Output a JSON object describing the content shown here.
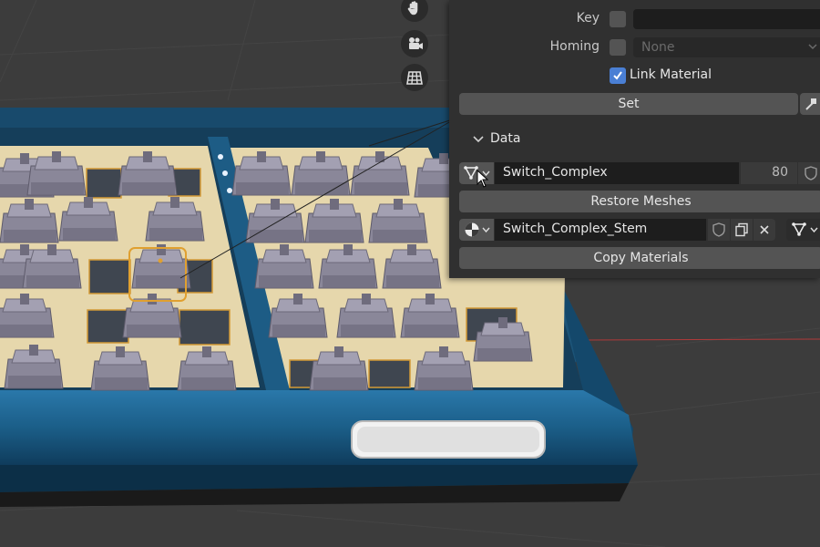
{
  "panel": {
    "key_label": "Key",
    "homing_label": "Homing",
    "homing_value": "None",
    "link_material_label": "Link Material",
    "link_material_checked": true,
    "set_label": "Set",
    "data_section_label": "Data",
    "mesh_name": "Switch_Complex",
    "mesh_users": "80",
    "restore_meshes_label": "Restore Meshes",
    "material_name": "Switch_Complex_Stem",
    "copy_materials_label": "Copy Materials"
  },
  "icons": {
    "viewport_tools": [
      "hand-icon",
      "camera-icon",
      "grid-icon"
    ],
    "panel": [
      "mesh-data-icon",
      "chevron-down-icon",
      "shield-icon",
      "material-icon",
      "duplicate-icon",
      "close-icon",
      "snap-icon"
    ]
  },
  "colors": {
    "panel_bg": "#303030",
    "field_bg": "#1d1d1d",
    "button_bg": "#545454",
    "accent_checkbox": "#4a7fd4",
    "keyboard_case": "#1f5a82",
    "plate": "#e6d7ac",
    "switch": "#8a8799",
    "selection_outline": "#e0a030"
  }
}
